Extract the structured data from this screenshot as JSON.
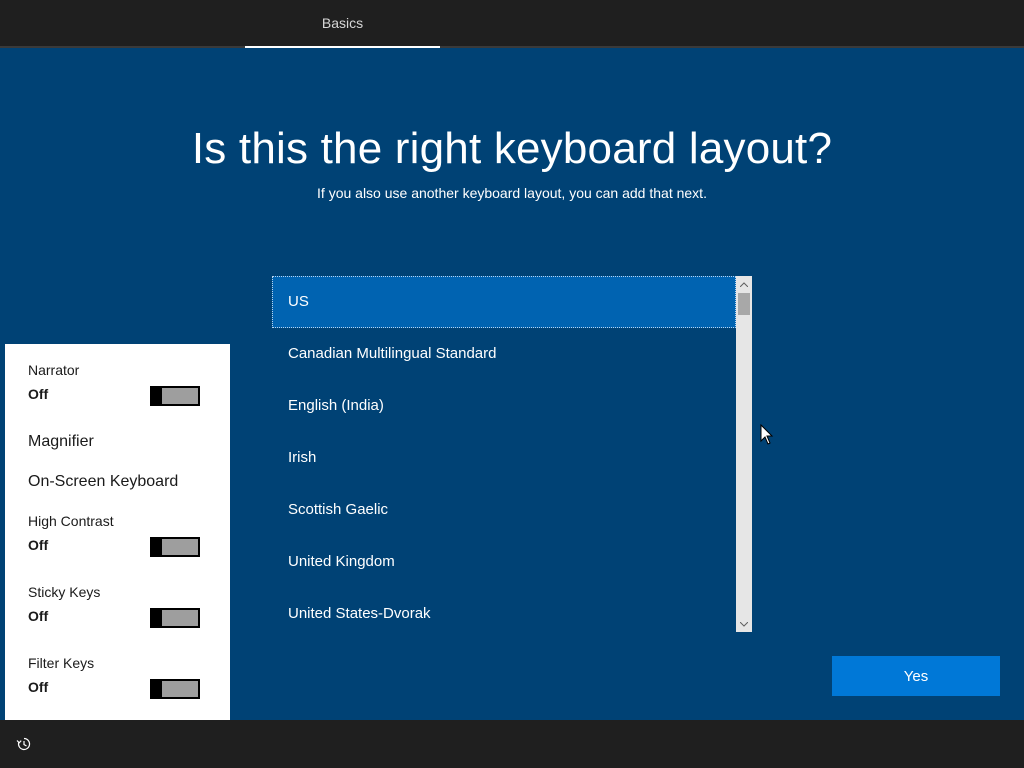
{
  "header": {
    "tab_label": "Basics"
  },
  "main": {
    "title": "Is this the right keyboard layout?",
    "subtitle": "If you also use another keyboard layout, you can add that next.",
    "layouts": [
      {
        "label": "US",
        "selected": true
      },
      {
        "label": "Canadian Multilingual Standard",
        "selected": false
      },
      {
        "label": "English (India)",
        "selected": false
      },
      {
        "label": "Irish",
        "selected": false
      },
      {
        "label": "Scottish Gaelic",
        "selected": false
      },
      {
        "label": "United Kingdom",
        "selected": false
      },
      {
        "label": "United States-Dvorak",
        "selected": false
      }
    ],
    "yes_button": "Yes"
  },
  "accessibility": {
    "narrator": {
      "label": "Narrator",
      "state": "Off"
    },
    "magnifier": {
      "label": "Magnifier"
    },
    "onscreen_keyboard": {
      "label": "On-Screen Keyboard"
    },
    "high_contrast": {
      "label": "High Contrast",
      "state": "Off"
    },
    "sticky_keys": {
      "label": "Sticky Keys",
      "state": "Off"
    },
    "filter_keys": {
      "label": "Filter Keys",
      "state": "Off"
    }
  },
  "footer": {
    "icon": "ease-of-access-icon"
  },
  "colors": {
    "background": "#004275",
    "selected": "#0063b1",
    "button": "#0078d7",
    "bar": "#1f1f1f"
  }
}
